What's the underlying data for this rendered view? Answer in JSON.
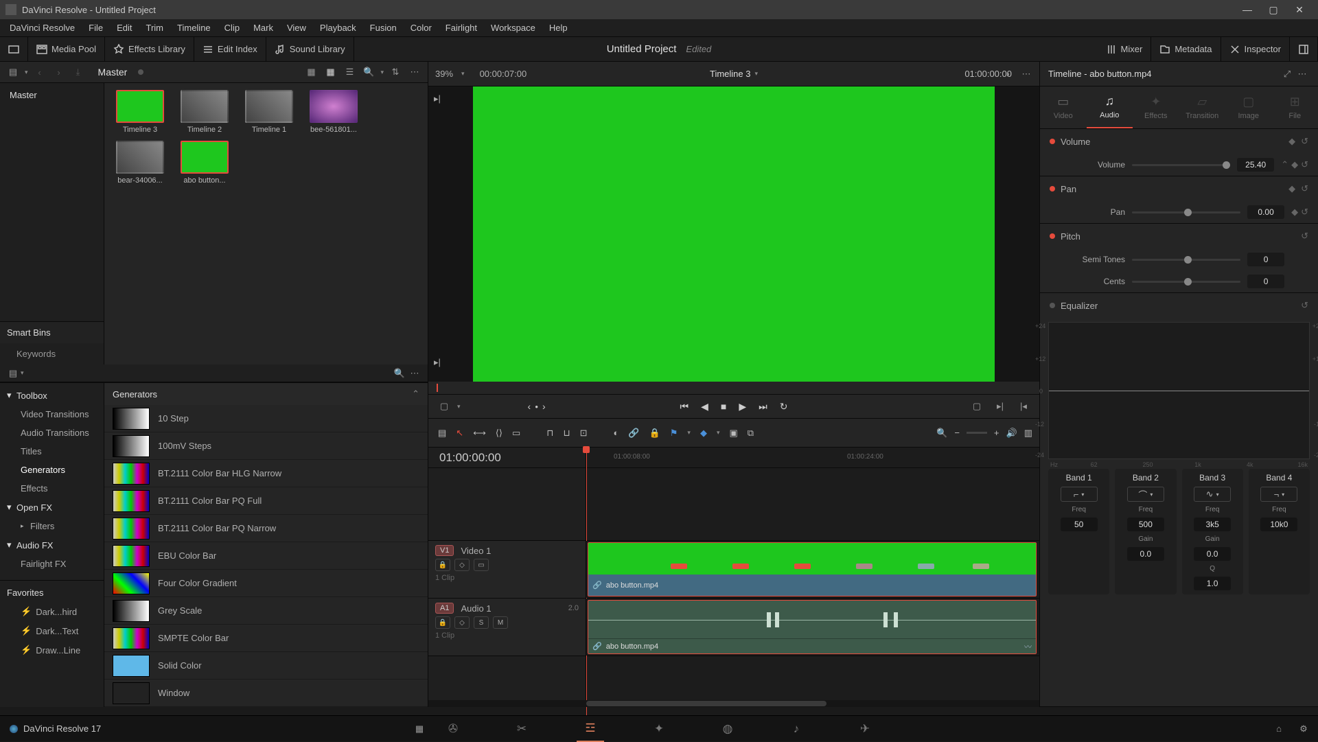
{
  "app": {
    "title": "DaVinci Resolve - Untitled Project",
    "brand": "DaVinci Resolve 17",
    "project_title": "Untitled Project",
    "project_status": "Edited"
  },
  "menu": [
    "DaVinci Resolve",
    "File",
    "Edit",
    "Trim",
    "Timeline",
    "Clip",
    "Mark",
    "View",
    "Playback",
    "Fusion",
    "Color",
    "Fairlight",
    "Workspace",
    "Help"
  ],
  "top_tools": {
    "media_pool": "Media Pool",
    "effects_library": "Effects Library",
    "edit_index": "Edit Index",
    "sound_library": "Sound Library",
    "mixer": "Mixer",
    "metadata": "Metadata",
    "inspector": "Inspector"
  },
  "media_nav": {
    "master": "Master",
    "smart_bins": "Smart Bins",
    "keywords": "Keywords"
  },
  "pool_items": [
    {
      "label": "Timeline 3",
      "kind": "timeline-t",
      "sel": true
    },
    {
      "label": "Timeline 2",
      "kind": "media"
    },
    {
      "label": "Timeline 1",
      "kind": "media"
    },
    {
      "label": "bee-561801...",
      "kind": "flower"
    },
    {
      "label": "bear-34006...",
      "kind": "media"
    },
    {
      "label": "abo button...",
      "kind": "green",
      "sel": true
    }
  ],
  "effects_tree": {
    "toolbox": "Toolbox",
    "video_transitions": "Video Transitions",
    "audio_transitions": "Audio Transitions",
    "titles": "Titles",
    "generators": "Generators",
    "effects": "Effects",
    "open_fx": "Open FX",
    "filters": "Filters",
    "audio_fx": "Audio FX",
    "fairlight_fx": "Fairlight FX",
    "favorites": "Favorites",
    "fav1": "Dark...hird",
    "fav2": "Dark...Text",
    "fav3": "Draw...Line"
  },
  "generators": {
    "header": "Generators",
    "items": [
      {
        "name": "10 Step",
        "swatch": "step"
      },
      {
        "name": "100mV Steps",
        "swatch": "step"
      },
      {
        "name": "BT.2111 Color Bar HLG Narrow",
        "swatch": "bars"
      },
      {
        "name": "BT.2111 Color Bar PQ Full",
        "swatch": "bars"
      },
      {
        "name": "BT.2111 Color Bar PQ Narrow",
        "swatch": "bars"
      },
      {
        "name": "EBU Color Bar",
        "swatch": "bars"
      },
      {
        "name": "Four Color Gradient",
        "swatch": "grad"
      },
      {
        "name": "Grey Scale",
        "swatch": "grey"
      },
      {
        "name": "SMPTE Color Bar",
        "swatch": "bars"
      },
      {
        "name": "Solid Color",
        "swatch": "solid"
      },
      {
        "name": "Window",
        "swatch": "win"
      }
    ]
  },
  "viewer": {
    "zoom": "39%",
    "left_tc": "00:00:07:00",
    "timeline_name": "Timeline 3",
    "right_tc": "01:00:00:00"
  },
  "timeline": {
    "current_tc": "01:00:00:00",
    "ruler_ticks": [
      "01:00:08:00",
      "01:00:24:00"
    ],
    "video_track": {
      "badge": "V1",
      "name": "Video 1",
      "clip_count": "1 Clip"
    },
    "audio_track": {
      "badge": "A1",
      "name": "Audio 1",
      "meter": "2.0",
      "clip_count": "1 Clip"
    },
    "clip_name": "abo button.mp4",
    "audio_btn_s": "S",
    "audio_btn_m": "M"
  },
  "inspector": {
    "header": "Timeline - abo button.mp4",
    "tabs": {
      "video": "Video",
      "audio": "Audio",
      "effects": "Effects",
      "transition": "Transition",
      "image": "Image",
      "file": "File"
    },
    "volume_sec": "Volume",
    "volume_lbl": "Volume",
    "volume_val": "25.40",
    "pan_sec": "Pan",
    "pan_lbl": "Pan",
    "pan_val": "0.00",
    "pitch_sec": "Pitch",
    "semi_lbl": "Semi Tones",
    "semi_val": "0",
    "cents_lbl": "Cents",
    "cents_val": "0",
    "eq_sec": "Equalizer",
    "eq_axis_left": [
      "+24",
      "+12",
      "0",
      "-12",
      "-24"
    ],
    "eq_axis_bot": [
      "Hz",
      "62",
      "250",
      "1k",
      "4k",
      "16k"
    ],
    "bands": [
      {
        "name": "Band 1",
        "freq_lbl": "Freq",
        "freq": "50"
      },
      {
        "name": "Band 2",
        "freq_lbl": "Freq",
        "freq": "500",
        "gain_lbl": "Gain",
        "gain": "0.0"
      },
      {
        "name": "Band 3",
        "freq_lbl": "Freq",
        "freq": "3k5",
        "gain_lbl": "Gain",
        "gain": "0.0",
        "q_lbl": "Q",
        "q": "1.0"
      },
      {
        "name": "Band 4",
        "freq_lbl": "Freq",
        "freq": "10k0"
      }
    ]
  }
}
